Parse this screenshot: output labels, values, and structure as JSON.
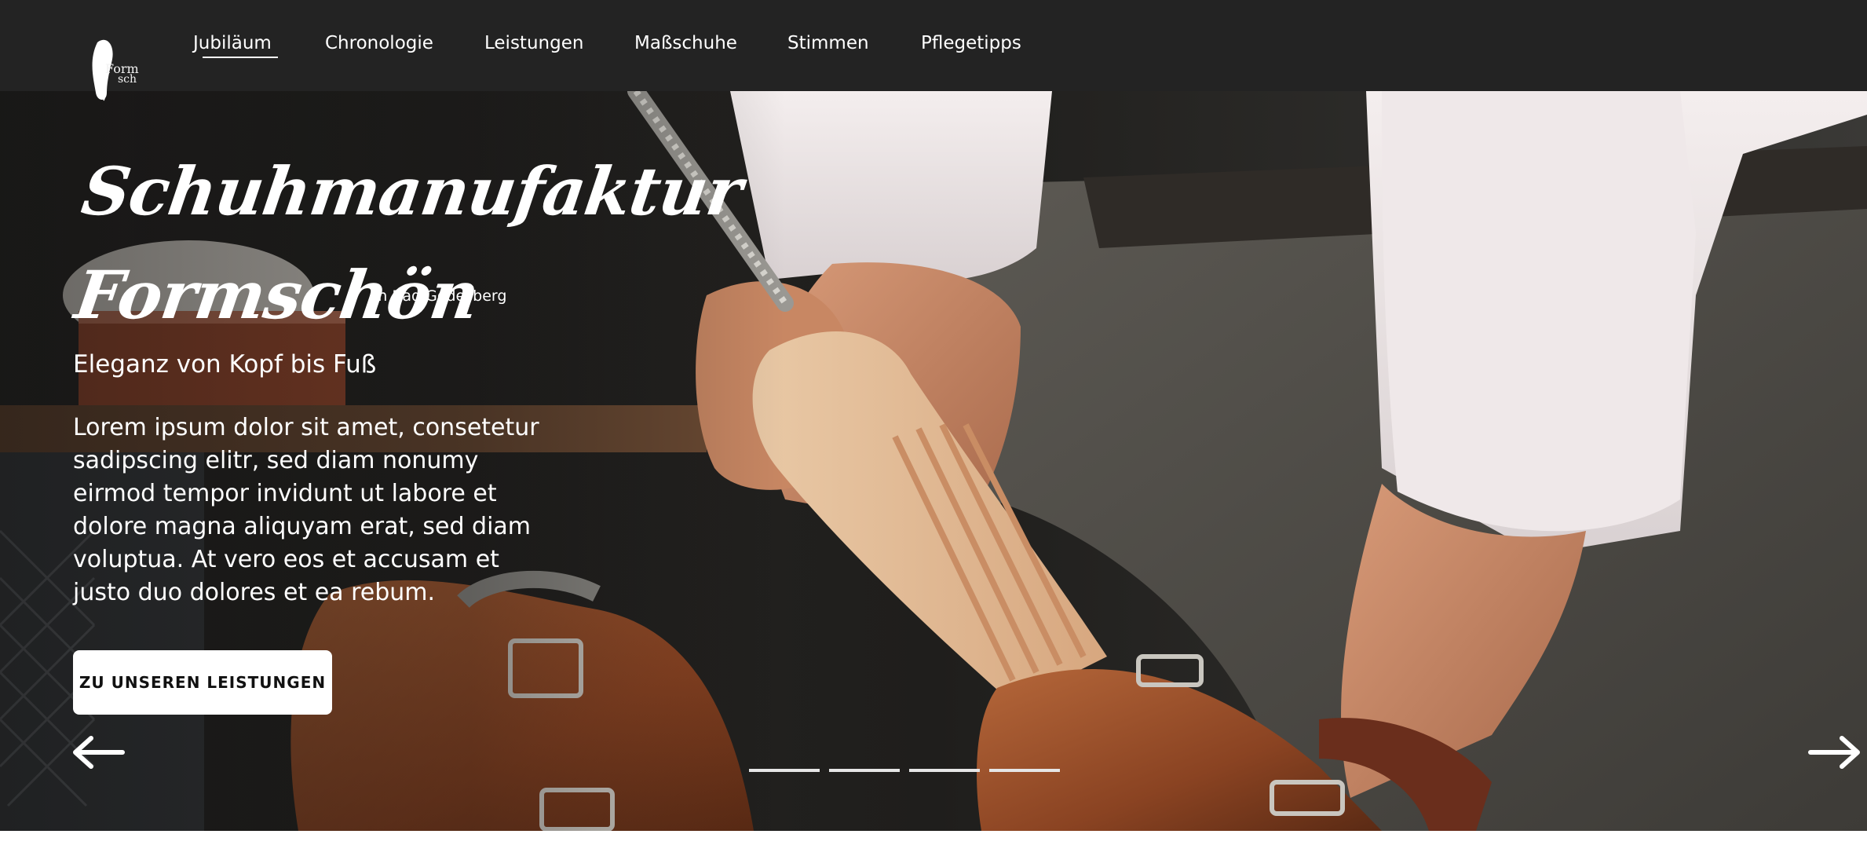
{
  "logo": {
    "text_top": "Form",
    "text_bottom": "sch"
  },
  "nav": {
    "items": [
      {
        "label": "Jubiläum",
        "active": true
      },
      {
        "label": "Chronologie"
      },
      {
        "label": "Leistungen"
      },
      {
        "label": "Maßschuhe"
      },
      {
        "label": "Stimmen"
      },
      {
        "label": "Pflegetipps"
      }
    ]
  },
  "hero": {
    "title_line1": "Schuhmanufaktur",
    "title_line2": "Formschön",
    "location": "in Bad Godesberg",
    "subtitle": "Eleganz von Kopf bis Fuß",
    "body": "Lorem ipsum dolor sit amet, consetetur sadipscing elitr, sed diam nonumy eirmod tempor invidunt ut labore et dolore magna aliquyam erat, sed diam voluptua. At vero eos et accusam et justo duo dolores et ea rebum.",
    "cta_label": "ZU UNSEREN LEISTUNGEN",
    "slides": 4,
    "icons": {
      "prev": "arrow-left-icon",
      "next": "arrow-right-icon"
    }
  },
  "colors": {
    "nav_bg": "#232323",
    "text": "#ffffff",
    "cta_bg": "#ffffff",
    "cta_text": "#111111"
  }
}
